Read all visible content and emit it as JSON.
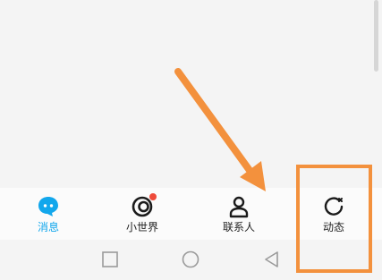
{
  "tabs": [
    {
      "label": "消息",
      "icon": "message-bubble-icon",
      "active": true
    },
    {
      "label": "小世界",
      "icon": "small-world-icon",
      "badge": true
    },
    {
      "label": "联系人",
      "icon": "contacts-icon"
    },
    {
      "label": "动态",
      "icon": "moments-icon"
    }
  ],
  "navbar": {
    "icons": [
      "recent-apps-icon",
      "home-icon",
      "back-icon"
    ]
  },
  "colors": {
    "accent": "#12a7ec",
    "badge": "#ee4a3a",
    "annotation": "#f3913d"
  }
}
